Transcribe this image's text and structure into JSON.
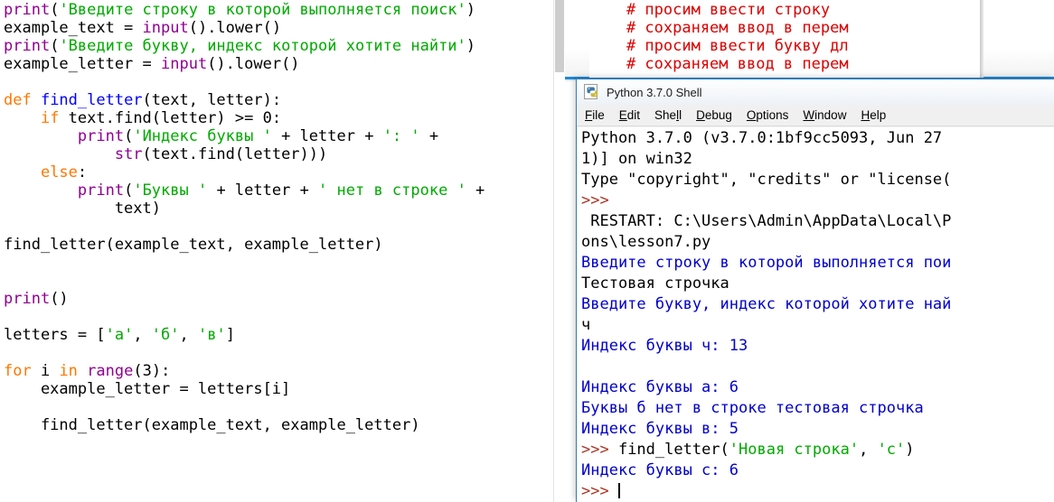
{
  "editor": {
    "window_name": "python-idle-editor",
    "code_lines": [
      [
        {
          "t": "print",
          "c": "bi"
        },
        {
          "t": "(",
          "c": "pl"
        },
        {
          "t": "'Введите строку в которой выполняется поиск'",
          "c": "str"
        },
        {
          "t": ")",
          "c": "pl"
        }
      ],
      [
        {
          "t": "example_text = ",
          "c": "pl"
        },
        {
          "t": "input",
          "c": "bi"
        },
        {
          "t": "().lower()",
          "c": "pl"
        }
      ],
      [
        {
          "t": "print",
          "c": "bi"
        },
        {
          "t": "(",
          "c": "pl"
        },
        {
          "t": "'Введите букву, индекс которой хотите найти'",
          "c": "str"
        },
        {
          "t": ")",
          "c": "pl"
        }
      ],
      [
        {
          "t": "example_letter = ",
          "c": "pl"
        },
        {
          "t": "input",
          "c": "bi"
        },
        {
          "t": "().lower()",
          "c": "pl"
        }
      ],
      [],
      [
        {
          "t": "def ",
          "c": "kw"
        },
        {
          "t": "find_letter",
          "c": "def"
        },
        {
          "t": "(text, letter):",
          "c": "pl"
        }
      ],
      [
        {
          "t": "    ",
          "c": "pl"
        },
        {
          "t": "if",
          "c": "kw"
        },
        {
          "t": " text.find(letter) >= 0:",
          "c": "pl"
        }
      ],
      [
        {
          "t": "        ",
          "c": "pl"
        },
        {
          "t": "print",
          "c": "bi"
        },
        {
          "t": "(",
          "c": "pl"
        },
        {
          "t": "'Индекс буквы '",
          "c": "str"
        },
        {
          "t": " + letter + ",
          "c": "pl"
        },
        {
          "t": "': '",
          "c": "str"
        },
        {
          "t": " +",
          "c": "pl"
        }
      ],
      [
        {
          "t": "            ",
          "c": "pl"
        },
        {
          "t": "str",
          "c": "bi"
        },
        {
          "t": "(text.find(letter)))",
          "c": "pl"
        }
      ],
      [
        {
          "t": "    ",
          "c": "pl"
        },
        {
          "t": "else",
          "c": "kw"
        },
        {
          "t": ":",
          "c": "pl"
        }
      ],
      [
        {
          "t": "        ",
          "c": "pl"
        },
        {
          "t": "print",
          "c": "bi"
        },
        {
          "t": "(",
          "c": "pl"
        },
        {
          "t": "'Буквы '",
          "c": "str"
        },
        {
          "t": " + letter + ",
          "c": "pl"
        },
        {
          "t": "' нет в строке '",
          "c": "str"
        },
        {
          "t": " +",
          "c": "pl"
        }
      ],
      [
        {
          "t": "            text)",
          "c": "pl"
        }
      ],
      [],
      [
        {
          "t": "find_letter(example_text, example_letter)",
          "c": "pl"
        }
      ],
      [],
      [],
      [
        {
          "t": "print",
          "c": "bi"
        },
        {
          "t": "()",
          "c": "pl"
        }
      ],
      [],
      [
        {
          "t": "letters = [",
          "c": "pl"
        },
        {
          "t": "'а'",
          "c": "str"
        },
        {
          "t": ", ",
          "c": "pl"
        },
        {
          "t": "'б'",
          "c": "str"
        },
        {
          "t": ", ",
          "c": "pl"
        },
        {
          "t": "'в'",
          "c": "str"
        },
        {
          "t": "]",
          "c": "pl"
        }
      ],
      [],
      [
        {
          "t": "for",
          "c": "kw"
        },
        {
          "t": " i ",
          "c": "pl"
        },
        {
          "t": "in",
          "c": "kw"
        },
        {
          "t": " ",
          "c": "pl"
        },
        {
          "t": "range",
          "c": "bi"
        },
        {
          "t": "(3):",
          "c": "pl"
        }
      ],
      [
        {
          "t": "    example_letter = letters[i]",
          "c": "pl"
        }
      ],
      [],
      [
        {
          "t": "    find_letter(example_text, example_letter)",
          "c": "pl"
        }
      ]
    ],
    "comment_lines": [
      "    # просим ввести строку",
      "    # сохраняем ввод в перем",
      "    # просим ввести букву дл",
      "    # сохраняем ввод в перем"
    ],
    "accent_color": "#1c8adb",
    "colors": {
      "keyword": "#ff7700",
      "builtin": "#900090",
      "string": "#00aa00",
      "definition": "#0000ff",
      "comment": "#dd0000",
      "plain": "#000000"
    }
  },
  "shell": {
    "title": "Python 3.7.0 Shell",
    "icon": "python-logo-icon",
    "menu": [
      {
        "label": "File",
        "accel": "F"
      },
      {
        "label": "Edit",
        "accel": "E"
      },
      {
        "label": "Shell",
        "accel": "l"
      },
      {
        "label": "Debug",
        "accel": "D"
      },
      {
        "label": "Options",
        "accel": "O"
      },
      {
        "label": "Window",
        "accel": "W"
      },
      {
        "label": "Help",
        "accel": "H"
      }
    ],
    "output_lines": [
      [
        {
          "t": "Python 3.7.0 (v3.7.0:1bf9cc5093, Jun 27",
          "c": "sblk"
        }
      ],
      [
        {
          "t": "1)] on win32",
          "c": "sblk"
        }
      ],
      [
        {
          "t": "Type \"copyright\", \"credits\" or \"license(",
          "c": "sblk"
        }
      ],
      [
        {
          "t": ">>>",
          "c": "prm"
        }
      ],
      [
        {
          "t": " RESTART: C:\\Users\\Admin\\AppData\\Local\\P",
          "c": "sblk"
        }
      ],
      [
        {
          "t": "ons\\lesson7.py",
          "c": "sblk"
        }
      ],
      [
        {
          "t": "Введите строку в которой выполняется пои",
          "c": "out"
        }
      ],
      [
        {
          "t": "Тестовая строчка",
          "c": "sblk"
        }
      ],
      [
        {
          "t": "Введите букву, индекс которой хотите най",
          "c": "out"
        }
      ],
      [
        {
          "t": "ч",
          "c": "sblk"
        }
      ],
      [
        {
          "t": "Индекс буквы ч: 13",
          "c": "out"
        }
      ],
      [],
      [
        {
          "t": "Индекс буквы а: 6",
          "c": "out"
        }
      ],
      [
        {
          "t": "Буквы б нет в строке тестовая строчка",
          "c": "out"
        }
      ],
      [
        {
          "t": "Индекс буквы в: 5",
          "c": "out"
        }
      ],
      [
        {
          "t": ">>> ",
          "c": "prm"
        },
        {
          "t": "find_letter(",
          "c": "sblk"
        },
        {
          "t": "'Новая строка'",
          "c": "sstr"
        },
        {
          "t": ", ",
          "c": "sblk"
        },
        {
          "t": "'с'",
          "c": "sstr"
        },
        {
          "t": ")",
          "c": "sblk"
        }
      ],
      [
        {
          "t": "Индекс буквы с: 6",
          "c": "out"
        }
      ],
      [
        {
          "t": ">>> ",
          "c": "prm"
        },
        {
          "t": "",
          "c": "caret"
        }
      ]
    ],
    "colors": {
      "output": "#0000cc",
      "prompt": "#aa3322",
      "string": "#00aa00",
      "stdout": "#000000",
      "border": "#3c7fb1"
    }
  }
}
